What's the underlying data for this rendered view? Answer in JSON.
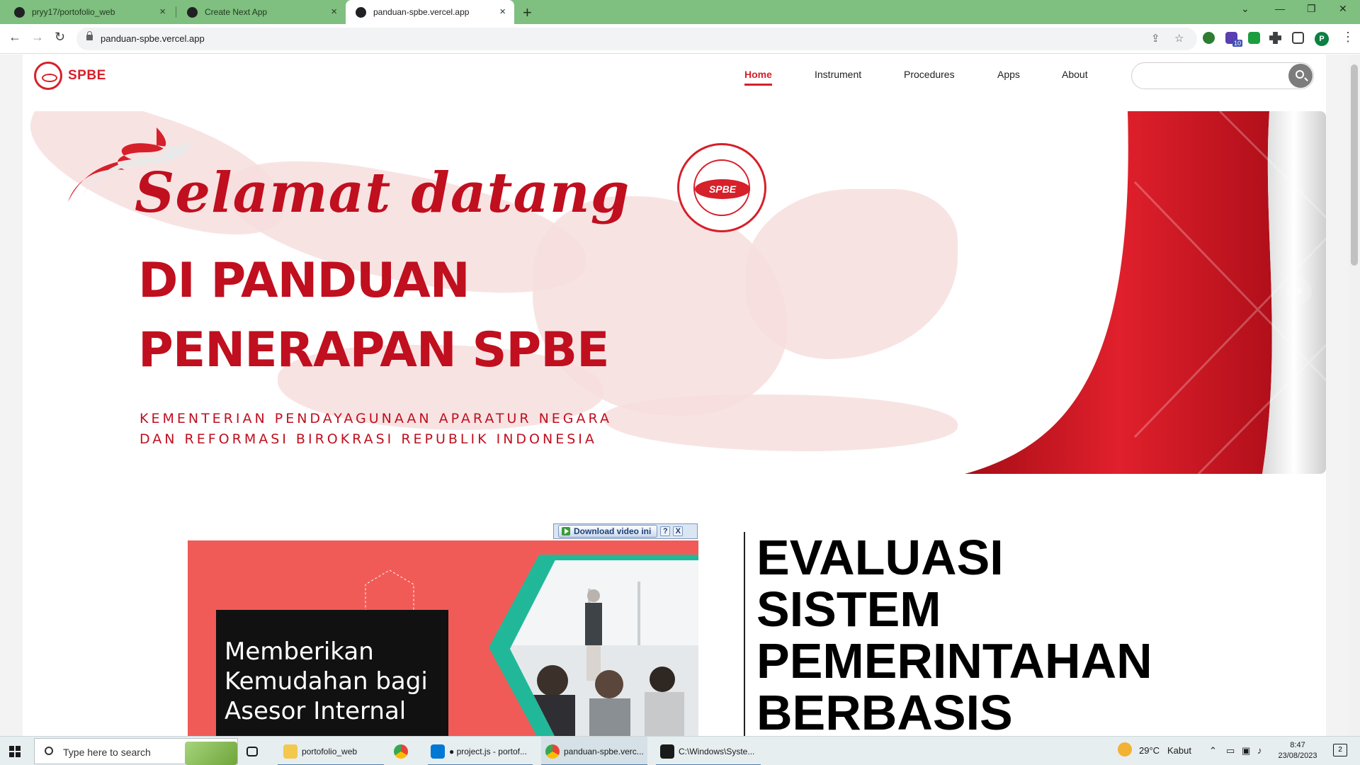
{
  "browser": {
    "tabs": [
      {
        "title": "pryy17/portofolio_web",
        "active": false
      },
      {
        "title": "Create Next App",
        "active": false
      },
      {
        "title": "panduan-spbe.vercel.app",
        "active": true
      }
    ],
    "new_tab": "+",
    "url": "panduan-spbe.vercel.app",
    "profile_initial": "P",
    "extension_badge": "10"
  },
  "site": {
    "brand": "SPBE",
    "nav": [
      {
        "label": "Home",
        "active": true
      },
      {
        "label": "Instrument",
        "active": false
      },
      {
        "label": "Procedures",
        "active": false
      },
      {
        "label": "Apps",
        "active": false
      },
      {
        "label": "About",
        "active": false
      }
    ],
    "search": {
      "placeholder": ""
    },
    "hero": {
      "greeting": "Selamat datang",
      "title_line1": "DI PANDUAN",
      "title_line2": "PENERAPAN SPBE",
      "subtitle": "KEMENTERIAN PENDAYAGUNAAN APARATUR NEGARA DAN REFORMASI BIROKRASI REPUBLIK INDONESIA",
      "seal_text": "SPBE",
      "next_arrow": "›"
    },
    "download_bar": {
      "label": "Download video ini",
      "help": "?",
      "close": "X"
    },
    "video": {
      "line1": "Memberikan",
      "line2": "Kemudahan bagi",
      "line3": "Asesor Internal"
    },
    "evaluation": {
      "line1": "EVALUASI",
      "line2": "SISTEM",
      "line3": "PEMERINTAHAN",
      "line4": "BERBASIS"
    }
  },
  "taskbar": {
    "search_placeholder": "Type here to search",
    "apps": [
      {
        "label": "portofolio_web",
        "color": "#f2c94c"
      },
      {
        "label": "",
        "color": "#34a853"
      },
      {
        "label": "● project.js - portof...",
        "color": "#0078d4"
      },
      {
        "label": "panduan-spbe.verc...",
        "color": "#34a853"
      },
      {
        "label": "C:\\Windows\\Syste...",
        "color": "#1a1a1a"
      }
    ],
    "weather_temp": "29°C",
    "weather_desc": "Kabut",
    "time": "8:47",
    "date": "23/08/2023",
    "notifications": "2"
  },
  "colors": {
    "accent_red": "#d6202a",
    "hero_red": "#c00f1e",
    "tabstrip": "#7fbf7f"
  }
}
